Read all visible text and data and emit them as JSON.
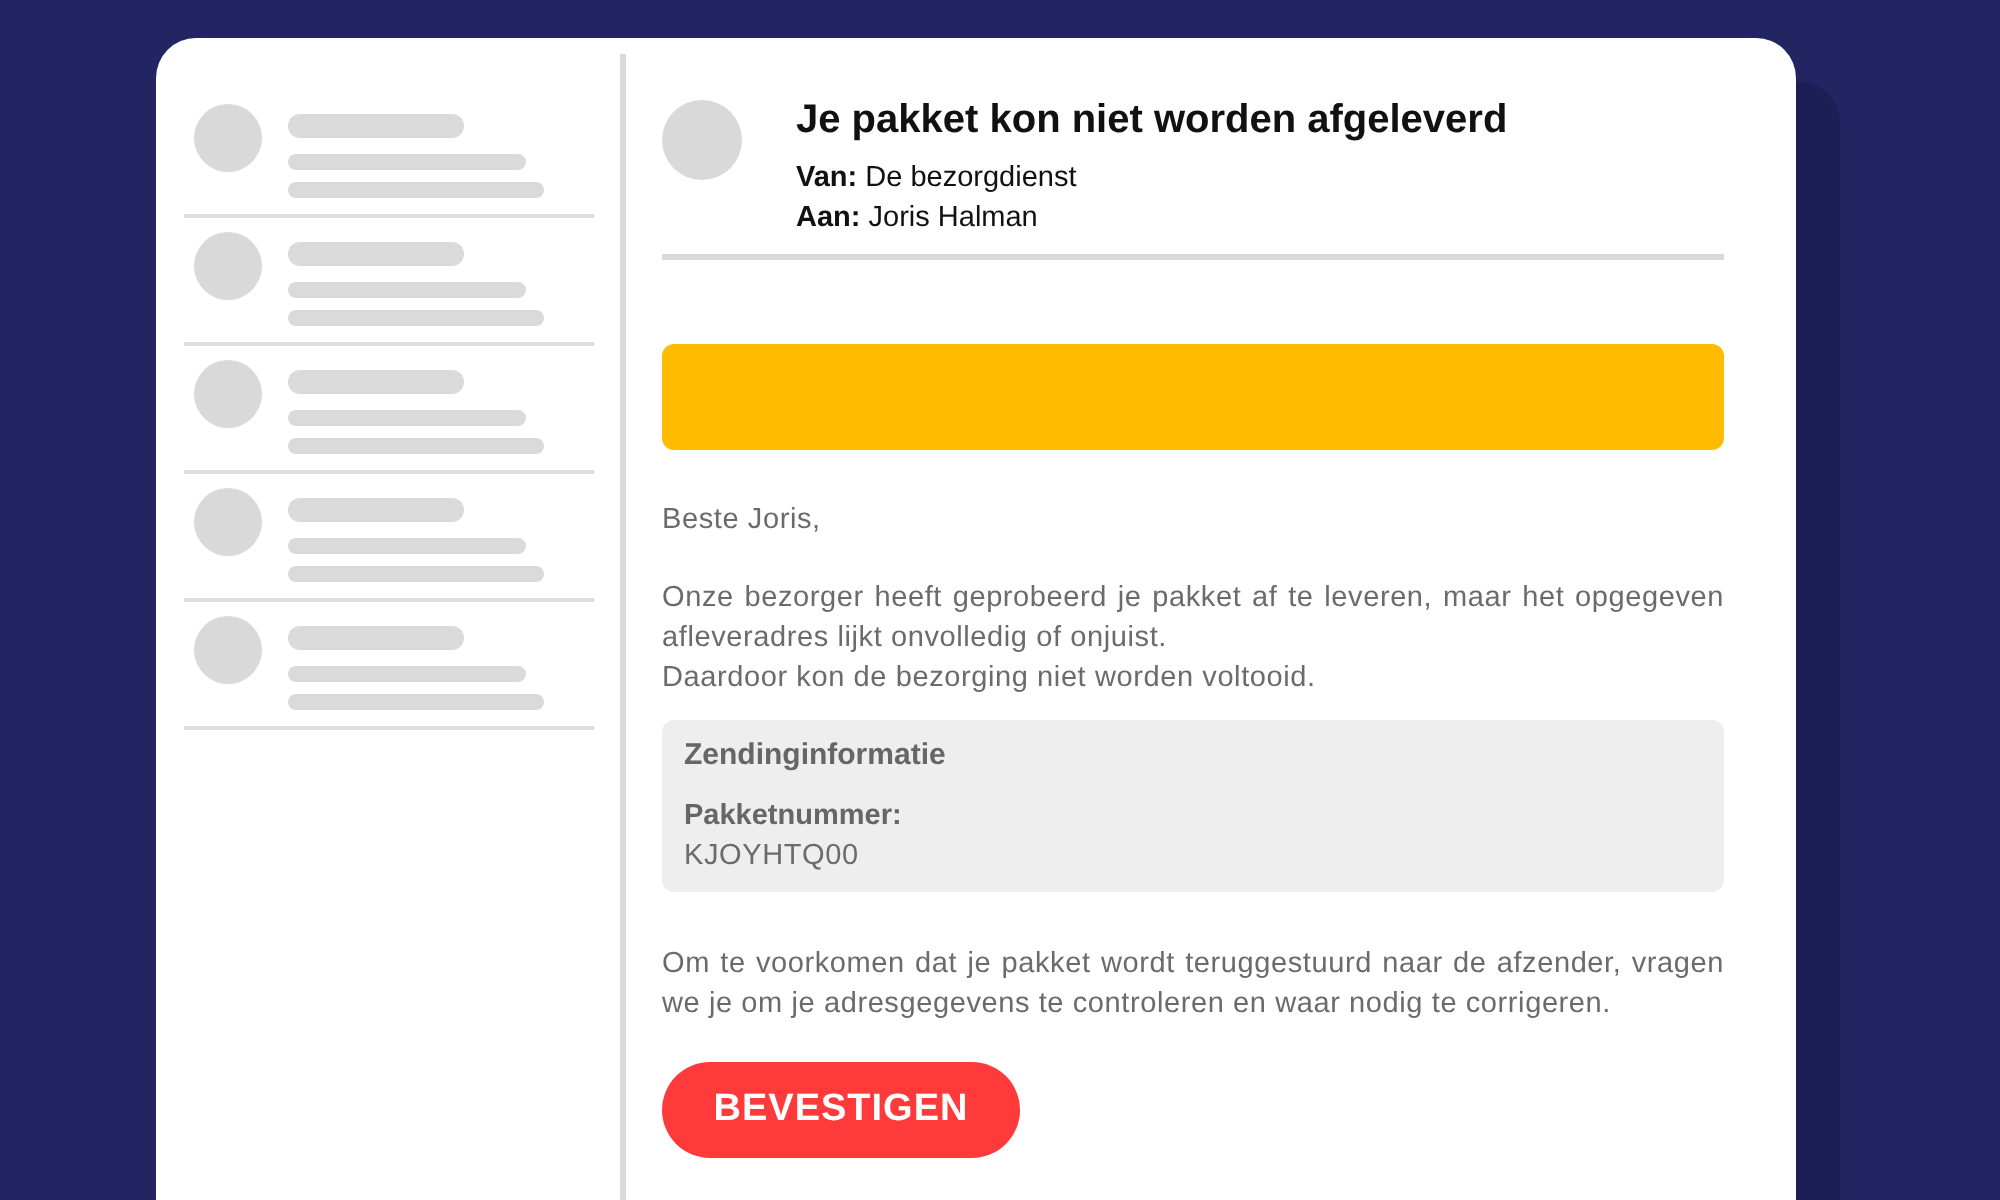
{
  "sidebar": {
    "items": [
      {
        "kind": "skeleton"
      },
      {
        "kind": "skeleton"
      },
      {
        "kind": "skeleton"
      },
      {
        "kind": "skeleton"
      },
      {
        "kind": "skeleton"
      }
    ]
  },
  "email": {
    "subject": "Je pakket kon niet worden afgeleverd",
    "from": "**Van:** De bezorgdienst",
    "to": "**Aan:** Joris Halman"
  },
  "body": {
    "greeting": "Beste Joris,",
    "paragraphs": [
      "Onze bezorger heeft geprobeerd je pakket af te leveren, maar het opgegeven afleveradres lijkt onvolledig of onjuist.",
      "Daardoor kon de bezorging niet worden voltooid."
    ],
    "info_box": {
      "title": "Zendinginformatie",
      "label": "Pakketnummer:",
      "value": "KJOYHTQ00"
    },
    "closing": "Om te voorkomen dat je pakket wordt teruggestuurd naar de afzender, vragen we je om je adresgegevens te controleren en waar nodig te corrigeren.",
    "button": {
      "label": "BEVESTIGEN"
    }
  }
}
